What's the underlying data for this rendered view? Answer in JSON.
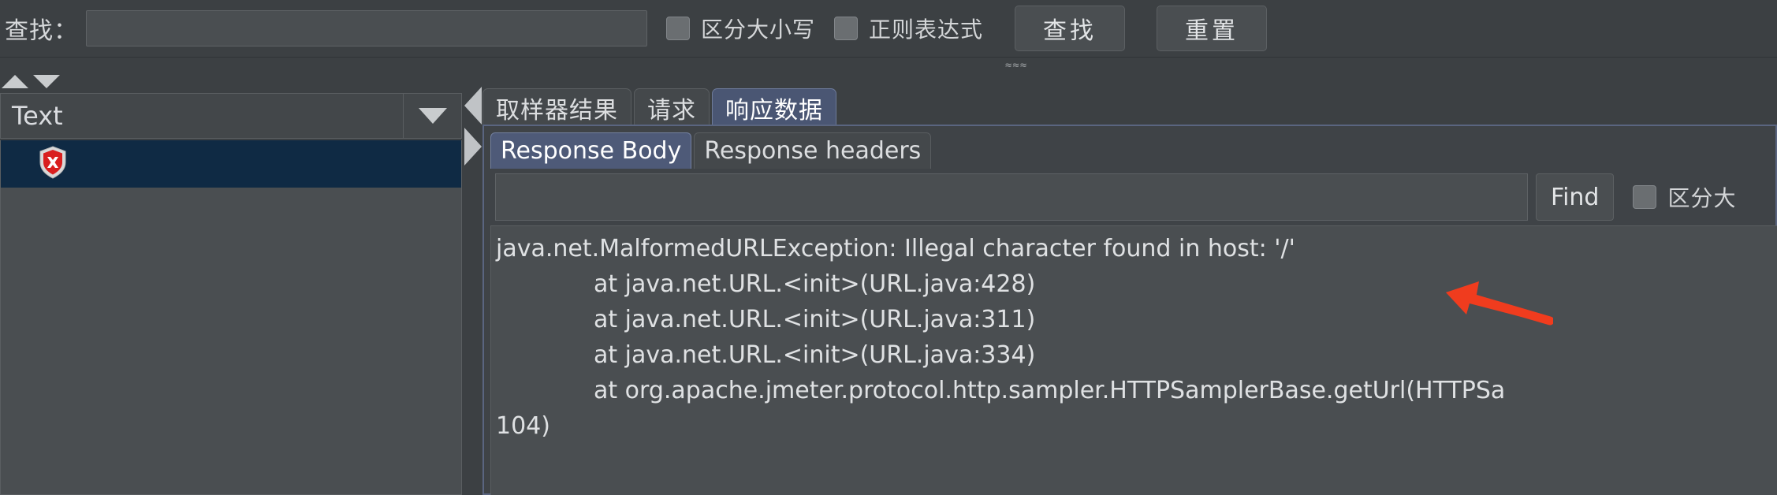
{
  "search_bar": {
    "label": "查找：",
    "input_value": "",
    "input_placeholder": "",
    "case_sensitive_label": "区分大小写",
    "regex_label": "正则表达式",
    "find_button": "查找",
    "reset_button": "重置"
  },
  "left_panel": {
    "scroll_up_icon": "triangle-up-icon",
    "scroll_down_icon": "triangle-down-icon",
    "combo_value": "Text",
    "combo_arrow_icon": "chevron-down-icon",
    "tree_item_icon": "error-shield-icon",
    "tree_item_label": ""
  },
  "splitter": {
    "collapse_left_icon": "triangle-left-icon",
    "expand_right_icon": "triangle-right-icon"
  },
  "right_panel": {
    "main_tabs": [
      {
        "label": "取样器结果",
        "active": false
      },
      {
        "label": "请求",
        "active": false
      },
      {
        "label": "响应数据",
        "active": true
      }
    ],
    "sub_tabs": [
      {
        "label": "Response Body",
        "active": true
      },
      {
        "label": "Response headers",
        "active": false
      }
    ],
    "find_bar": {
      "input_value": "",
      "input_placeholder": "",
      "find_button": "Find",
      "case_sensitive_label": "区分大"
    },
    "response_body": "java.net.MalformedURLException: Illegal character found in host: '/'\n             at java.net.URL.<init>(URL.java:428)\n             at java.net.URL.<init>(URL.java:311)\n             at java.net.URL.<init>(URL.java:334)\n             at org.apache.jmeter.protocol.http.sampler.HTTPSamplerBase.getUrl(HTTPSa\n104)"
  },
  "annotation": {
    "arrow_color": "#f03c1e",
    "arrow_icon": "left-arrow-annotation-icon"
  },
  "colors": {
    "window_bg": "#3c4043",
    "field_bg": "#4a4e51",
    "selection_blue": "#0f2a44",
    "active_tab_blue": "#4a5673",
    "text": "#dfe1e3"
  }
}
